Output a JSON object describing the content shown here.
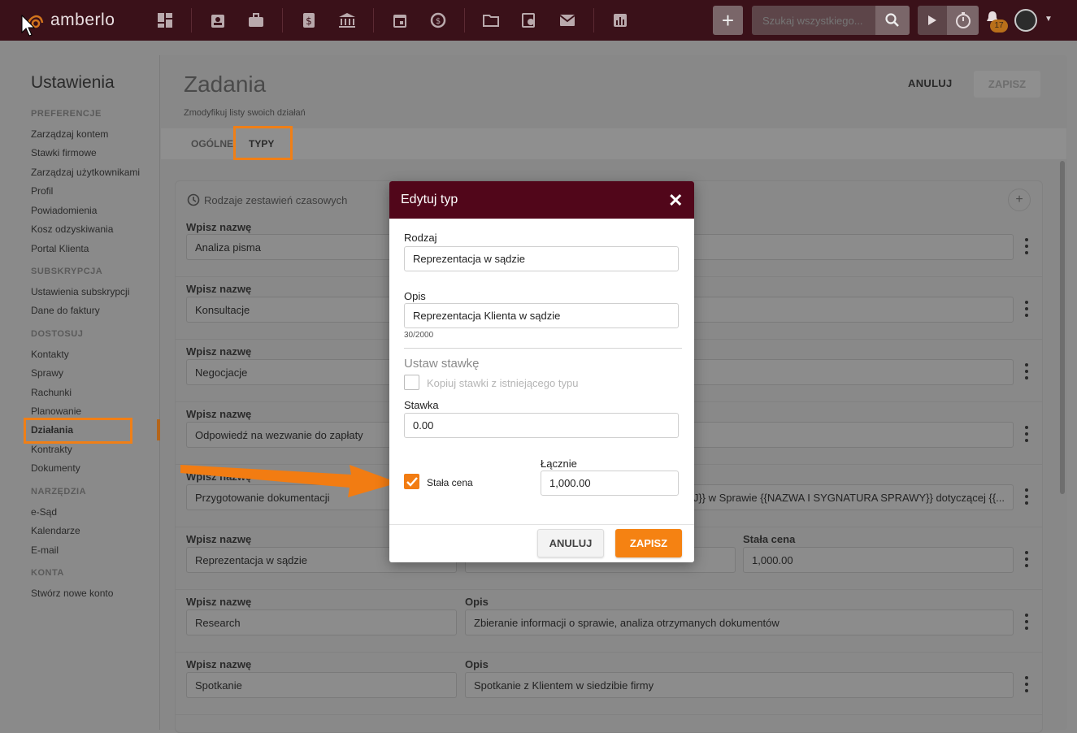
{
  "app": {
    "logo": "amberlo",
    "search_placeholder": "Szukaj wszystkiego...",
    "notifications_count": "17",
    "accent_color": "#f27c12",
    "header_color": "#3a1119",
    "nav_icons": [
      "dashboard-icon",
      "contacts-icon",
      "cases-icon",
      "billing-icon",
      "bank-icon",
      "calendar-icon",
      "time-icon",
      "folder-icon",
      "documents-icon",
      "mail-icon",
      "reports-icon"
    ]
  },
  "sidebar": {
    "title": "Ustawienia",
    "sections": [
      {
        "label": "PREFERENCJE",
        "items": [
          "Zarządzaj kontem",
          "Stawki firmowe",
          "Zarządzaj użytkownikami",
          "Profil",
          "Powiadomienia",
          "Kosz odzyskiwania",
          "Portal Klienta"
        ]
      },
      {
        "label": "SUBSKRYPCJA",
        "items": [
          "Ustawienia subskrypcji",
          "Dane do faktury"
        ]
      },
      {
        "label": "DOSTOSUJ",
        "items": [
          "Kontakty",
          "Sprawy",
          "Rachunki",
          "Planowanie",
          "Działania",
          "Kontrakty",
          "Dokumenty"
        ]
      },
      {
        "label": "NARZĘDZIA",
        "items": [
          "e-Sąd",
          "Kalendarze",
          "E-mail"
        ]
      },
      {
        "label": "KONTA",
        "items": [
          "Stwórz nowe konto"
        ]
      }
    ],
    "active_item": "Działania"
  },
  "main": {
    "title": "Zadania",
    "subtitle": "Zmodyfikuj listy swoich działań",
    "cancel_label": "ANULUJ",
    "save_label": "ZAPISZ",
    "tabs": [
      "OGÓLNE",
      "TYPY"
    ],
    "active_tab": "TYPY",
    "card_title": "Rodzaje zestawień czasowych",
    "rows": [
      {
        "name_label": "Wpisz nazwę",
        "name": "Analiza pisma"
      },
      {
        "name_label": "Wpisz nazwę",
        "name": "Konsultacje"
      },
      {
        "name_label": "Wpisz nazwę",
        "name": "Negocjacje"
      },
      {
        "name_label": "Wpisz nazwę",
        "name": "Odpowiedź na wezwanie do zapłaty"
      },
      {
        "name_label": "Wpisz nazwę",
        "name": "Przygotowanie dokumentacji",
        "desc_tail": "J}} w Sprawie {{NAZWA I SYGNATURA SPRAWY}} dotyczącej {{..."
      },
      {
        "name_label": "Wpisz nazwę",
        "name": "Reprezentacja w sądzie",
        "price_label": "Stała cena",
        "price": "1,000.00"
      },
      {
        "name_label": "Wpisz nazwę",
        "name": "Research",
        "desc_label": "Opis",
        "desc": "Zbieranie informacji o sprawie, analiza otrzymanych dokumentów"
      },
      {
        "name_label": "Wpisz nazwę",
        "name": "Spotkanie",
        "desc_label": "Opis",
        "desc": "Spotkanie z Klientem w siedzibie firmy"
      }
    ]
  },
  "modal": {
    "title": "Edytuj typ",
    "type_label": "Rodzaj",
    "type_value": "Reprezentacja w sądzie",
    "desc_label": "Opis",
    "desc_value": "Reprezentacja Klienta w sądzie",
    "char_count": "30/2000",
    "rate_section": "Ustaw stawkę",
    "copy_rates_label": "Kopiuj stawki z istniejącego typu",
    "copy_rates_checked": false,
    "rate_label": "Stawka",
    "rate_value": "0.00",
    "fixed_price_label": "Stała cena",
    "fixed_price_checked": true,
    "total_label": "Łącznie",
    "total_value": "1,000.00",
    "cancel_label": "ANULUJ",
    "save_label": "ZAPISZ"
  }
}
